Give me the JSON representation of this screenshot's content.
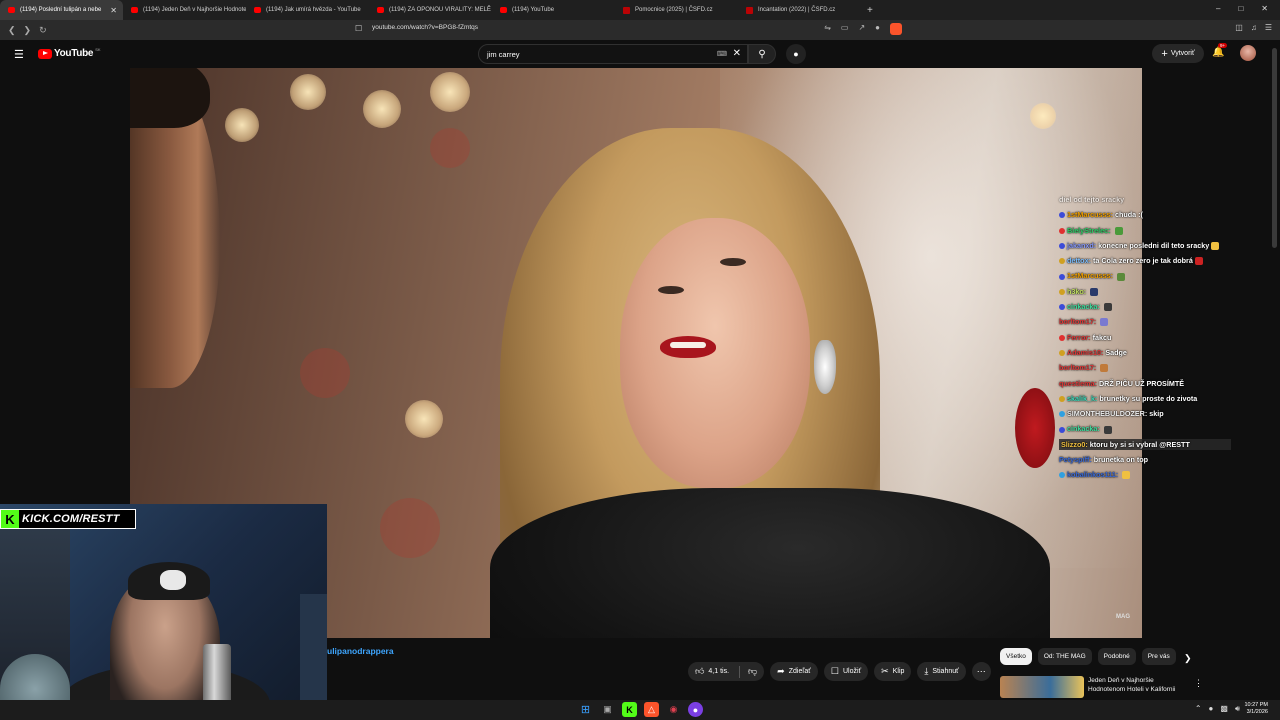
{
  "browser": {
    "tabs": [
      {
        "label": "(1194) Poslední tulipán a nebe",
        "favicon": "youtube-icon",
        "active": true
      },
      {
        "label": "(1194) Jeden Deň v Najhoršie Hodnotenom",
        "favicon": "youtube-icon"
      },
      {
        "label": "(1194) Jak umírá hvězda - YouTube",
        "favicon": "youtube-icon"
      },
      {
        "label": "(1194) ZA OPONOU VIRALITY: MELĚ",
        "favicon": "youtube-icon"
      },
      {
        "label": "(1194) YouTube",
        "favicon": "youtube-icon"
      },
      {
        "label": "Pomocnice (2025) | ČSFD.cz",
        "favicon": "csfd-icon"
      },
      {
        "label": "Incantation (2022) | ČSFD.cz",
        "favicon": "csfd-icon"
      }
    ],
    "new_tab": "+",
    "url": "youtube.com/watch?v=BPG8-fZmtqs"
  },
  "youtube": {
    "logo_text": "YouTube",
    "country_code": "SK",
    "search_value": "jim carrey",
    "create_label": "Vytvoriť",
    "notification_count": "9+"
  },
  "chat": {
    "partial_top": "diel od tejto sracky",
    "messages": [
      {
        "user": "1stMarcusss:",
        "text": "chuda :(",
        "color": "#f0a000",
        "icon_color": "#3b4bd8"
      },
      {
        "user": "BielyStrelec:",
        "text": "",
        "color": "#2fd36a",
        "icon_color": "#e03030",
        "emote": "#4a9a3a"
      },
      {
        "user": "jakanxd:",
        "text": "konecne posledni dil teto sracky",
        "color": "#8a9cff",
        "icon_color": "#3b4bd8",
        "emote": "#f0c040"
      },
      {
        "user": "dettox:",
        "text": "ta Cola zero zero je tak dobrá",
        "color": "#7fc0ff",
        "icon_color": "#d0a020",
        "emote": "#cc2222"
      },
      {
        "user": "1stMarcusss:",
        "text": "",
        "color": "#f0a000",
        "icon_color": "#3b4bd8",
        "emote": "#5a8a3a"
      },
      {
        "user": "h3ko:",
        "text": "",
        "color": "#c0e060",
        "icon_color": "#d0a020",
        "emote": "#2a3a6a"
      },
      {
        "user": "cinkacka:",
        "text": "",
        "color": "#40e0a0",
        "icon_color": "#3b4bd8",
        "emote": "#3a3a3a"
      },
      {
        "user": "borltom17:",
        "text": "",
        "color": "#e03a3a",
        "icon_color": "",
        "emote": "#7a7ad0"
      },
      {
        "user": "Ferror:",
        "text": "fakcu",
        "color": "#e03a3a",
        "icon_color": "#e03030"
      },
      {
        "user": "Adamis10:",
        "text": "Sadge",
        "color": "#e03a3a",
        "icon_color": "#d0a020"
      },
      {
        "user": "borltom17:",
        "text": "",
        "color": "#e03a3a",
        "icon_color": "",
        "emote": "#c07a3a"
      },
      {
        "user": "questiema:",
        "text": "DRŽ PIČU UŽ PROSÍMTĚ",
        "color": "#e03a3a",
        "icon_color": ""
      },
      {
        "user": "skalik_k:",
        "text": "brunetky su proste do zivota",
        "color": "#40e0c0",
        "icon_color": "#d0a020"
      },
      {
        "user": "SIMONTHEBULDOZER:",
        "text": "skip",
        "color": "#f1f1f1",
        "icon_color": "#30a0e0"
      },
      {
        "user": "cinkacka:",
        "text": "",
        "color": "#40e0a0",
        "icon_color": "#3b4bd8",
        "emote": "#3a3a3a"
      },
      {
        "user": "Slizzo0:",
        "text": "ktoru by si si vybral @RESTT",
        "color": "#f0c040",
        "icon_color": "",
        "highlight": true
      },
      {
        "user": "Petyspiff:",
        "text": "brunetka on top",
        "color": "#3b6bd8",
        "icon_color": ""
      },
      {
        "user": "kobalinkos111:",
        "text": "",
        "color": "#3b6bd8",
        "icon_color": "#30a0e0",
        "emote": "#f0c040"
      }
    ]
  },
  "stream": {
    "kick_banner": "KICK.COM/RESTT",
    "watermark": "MAG"
  },
  "below_video": {
    "channel_name": "ulipanodrappera",
    "like_count": "4,1 tis.",
    "share_label": "Zdieľať",
    "save_label": "Uložiť",
    "clip_label": "Klip",
    "download_label": "Stiahnuť"
  },
  "chips": [
    "Všetko",
    "Od: THE MAG",
    "Podobné",
    "Pre vás"
  ],
  "recommendation": {
    "title": "Jeden Deň v Najhoršie Hodnotenom Hoteli v Kalifornii"
  },
  "taskbar": {
    "time": "10:27 PM",
    "date": "3/1/2026"
  }
}
